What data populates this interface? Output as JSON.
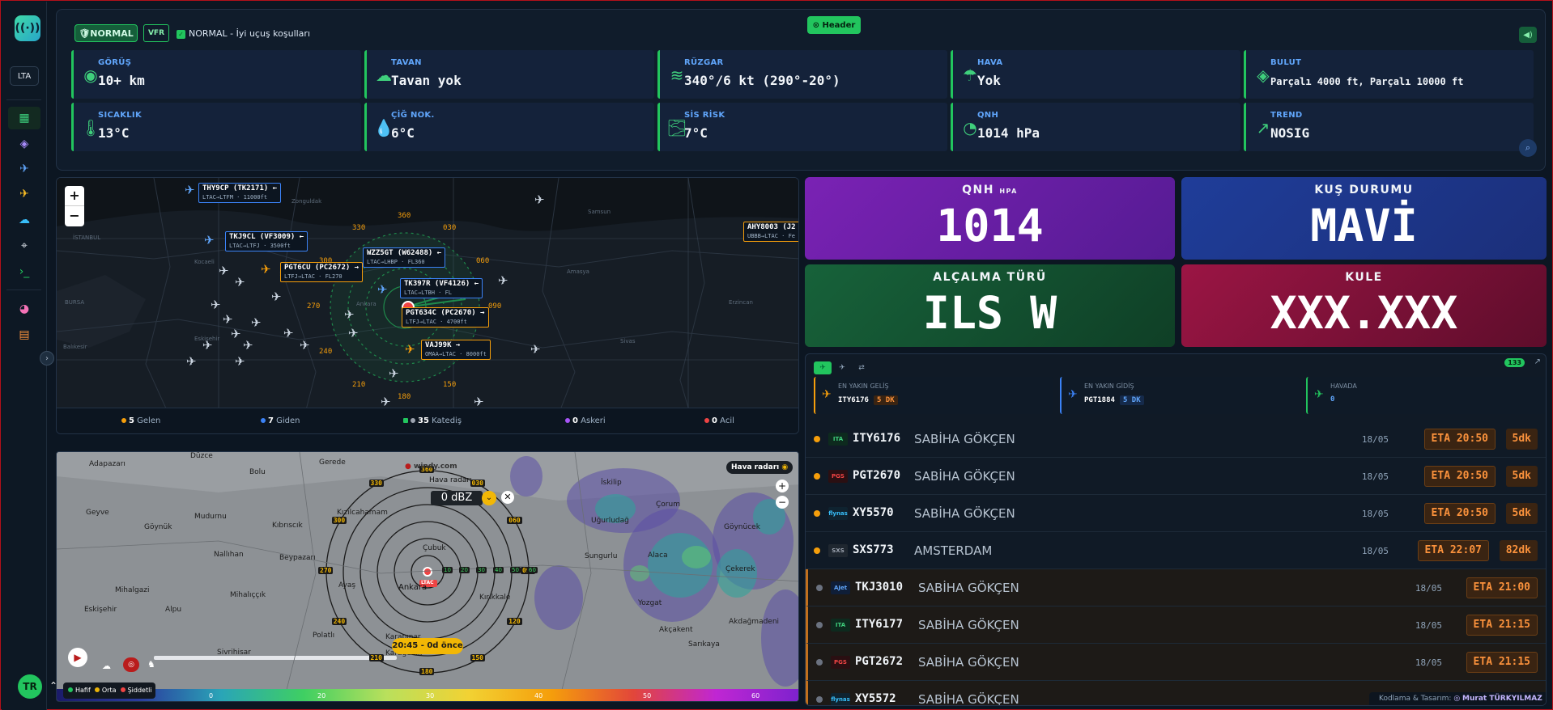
{
  "sidebar": {
    "logo_glyph": "((·))",
    "lang": "LTA",
    "icons": [
      "grid-icon",
      "layers-icon",
      "departure-plane-icon",
      "arrival-plane-icon",
      "weather-icon",
      "crosshair-icon",
      "terminal-icon",
      "palette-icon",
      "calculator-icon"
    ],
    "avatar": "TR",
    "collapse_glyph": "›"
  },
  "header_toggle": "⊙ Header",
  "status": {
    "badge": "NORMAL",
    "rule": "VFR",
    "condition": "NORMAL - İyi uçuş koşulları"
  },
  "weather": [
    {
      "label": "GÖRÜŞ",
      "value": "10+ km",
      "icon": "eye-icon",
      "glyph": "◉"
    },
    {
      "label": "TAVAN",
      "value": "Tavan yok",
      "icon": "cloud-icon",
      "glyph": "☁"
    },
    {
      "label": "RÜZGAR",
      "value": "340°/6 kt (290°-20°)",
      "icon": "wind-icon",
      "glyph": "≋"
    },
    {
      "label": "HAVA",
      "value": "Yok",
      "icon": "rain-cloud-icon",
      "glyph": "☂"
    },
    {
      "label": "BULUT",
      "value": "Parçalı 4000 ft, Parçalı 10000 ft",
      "icon": "layers-icon",
      "glyph": "◈"
    },
    {
      "label": "SICAKLIK",
      "value": "13°C",
      "icon": "thermometer-icon",
      "glyph": "🌡"
    },
    {
      "label": "ÇİĞ NOK.",
      "value": "6°C",
      "icon": "droplet-icon",
      "glyph": "💧"
    },
    {
      "label": "SİS RİSK",
      "value": "7°C",
      "icon": "fog-icon",
      "glyph": "🌫"
    },
    {
      "label": "QNH",
      "value": "1014 hPa",
      "icon": "gauge-icon",
      "glyph": "◔"
    },
    {
      "label": "TREND",
      "value": "NOSIG",
      "icon": "trend-icon",
      "glyph": "↗"
    }
  ],
  "flight_map": {
    "zoom_in": "+",
    "zoom_out": "−",
    "compass": [
      "360",
      "030",
      "060",
      "090",
      "120",
      "150",
      "180",
      "210",
      "240",
      "270",
      "300",
      "330"
    ],
    "map_labels": [
      "İSTANBUL",
      "BURSA",
      "Balıkesir",
      "Ankara",
      "Kocaeli",
      "Eskişehir",
      "Samsun",
      "Amasya",
      "Sivas",
      "Erzincan",
      "Zonguldak"
    ],
    "tags": [
      {
        "call": "THY9CP (TK2171) ←",
        "route": "LTAC→LTFM · 11000ft",
        "color": "blue"
      },
      {
        "call": "TKJ9CL (VF3009) ←",
        "route": "LTAC→LTFJ · 3500ft",
        "color": "blue"
      },
      {
        "call": "PGT6CU (PC2672) →",
        "route": "LTFJ→LTAC · FL270",
        "color": "orange"
      },
      {
        "call": "WZZ5GT (W62488) ←",
        "route": "LTAC→LHBP · FL360",
        "color": "blue"
      },
      {
        "call": "TK397R (VF4126) ←",
        "route": "LTAC→LTBH · FL",
        "color": "blue"
      },
      {
        "call": "PGT634C (PC2670) →",
        "route": "LTFJ→LTAC · 4700ft",
        "color": "orange"
      },
      {
        "call": "VAJ99K →",
        "route": "OMAA→LTAC · 8000ft",
        "color": "orange"
      },
      {
        "call": "AHY8003 (J2",
        "route": "UBBB→LTAC · Fe",
        "color": "orange"
      }
    ],
    "stats": [
      {
        "num": "5",
        "label": "Gelen",
        "color": "#f59e0b"
      },
      {
        "num": "7",
        "label": "Giden",
        "color": "#3b82f6"
      },
      {
        "num": "35",
        "label": "Katediş",
        "color": "#9ca3af"
      },
      {
        "num": "0",
        "label": "Askeri",
        "color": "#a855f7"
      },
      {
        "num": "0",
        "label": "Acil",
        "color": "#ef4444"
      }
    ]
  },
  "radar_map": {
    "cities": [
      "Adapazarı",
      "Düzce",
      "Bolu",
      "Gerede",
      "Geyve",
      "Mudurnu",
      "Kıbrıscık",
      "Göynük",
      "Nallıhan",
      "Beypazarı",
      "Mihalgazi",
      "Mihalıççık",
      "Eskişehir",
      "Alpu",
      "Ayaş",
      "Ankara",
      "Polatlı",
      "Karapınar",
      "Kırıkkale",
      "Yozgat",
      "Akçakent",
      "Sarıkaya",
      "Akdağmadeni",
      "Çorum",
      "Uğurludağ",
      "Sungurlu",
      "Alaca",
      "Çekerek",
      "İskilip",
      "Göynücek",
      "Sivrihisar",
      "Kızılcahamam",
      "Çubuk",
      "Karagedik"
    ],
    "compass": [
      "360",
      "030",
      "060",
      "090",
      "120",
      "150",
      "180",
      "210",
      "240",
      "270",
      "300",
      "330"
    ],
    "range_marks": [
      "10",
      "20",
      "30",
      "40",
      "50",
      "60"
    ],
    "dbz": "0 dBZ",
    "hava_radari": "Hava radarı",
    "hava_radari_2": "Hava radarı",
    "windy": "windy.com",
    "time": "20:45 - 0d önce",
    "airport": "LTAC",
    "scale": [
      "0",
      "20",
      "30",
      "40",
      "50",
      "60"
    ],
    "legend": [
      {
        "label": "Hafif",
        "color": "#22c55e"
      },
      {
        "label": "Orta",
        "color": "#eab308"
      },
      {
        "label": "Şiddetli",
        "color": "#ef4444"
      }
    ]
  },
  "cards": [
    {
      "title": "QNH",
      "suffix": "HPA",
      "value": "1014",
      "bg": "#6b22a8"
    },
    {
      "title": "KUŞ DURUMU",
      "suffix": "",
      "value": "MAVİ",
      "bg": "#1e3a8a"
    },
    {
      "title": "ALÇALMA TÜRÜ",
      "suffix": "",
      "value": "ILS W",
      "bg": "#14532d"
    },
    {
      "title": "KULE",
      "suffix": "",
      "value": "XXX.XXX",
      "bg": "#8a1338"
    }
  ],
  "flights": {
    "count": "133",
    "tabs": [
      "arrival-tab-icon",
      "departure-tab-icon",
      "swap-icon"
    ],
    "nearest": [
      {
        "label": "EN YAKIN GELİŞ",
        "flight": "ITY6176",
        "badge": "5 DK",
        "color": "#f59e0b"
      },
      {
        "label": "EN YAKIN GİDİŞ",
        "flight": "PGT1884",
        "badge": "5 DK",
        "color": "#3b82f6"
      },
      {
        "label": "HAVADA",
        "flight": "0",
        "badge": "",
        "color": "#22c55e"
      }
    ],
    "rows": [
      {
        "call": "ITY6176",
        "airport": "SABİHA GÖKÇEN",
        "date": "18/05",
        "eta": "ETA 20:50",
        "dk": "5dk",
        "logo": "ITA",
        "status": "active"
      },
      {
        "call": "PGT2670",
        "airport": "SABİHA GÖKÇEN",
        "date": "18/05",
        "eta": "ETA 20:50",
        "dk": "5dk",
        "logo": "PGS",
        "status": "active"
      },
      {
        "call": "XY5570",
        "airport": "SABİHA GÖKÇEN",
        "date": "18/05",
        "eta": "ETA 20:50",
        "dk": "5dk",
        "logo": "flynas",
        "status": "active"
      },
      {
        "call": "SXS773",
        "airport": "AMSTERDAM",
        "date": "18/05",
        "eta": "ETA 22:07",
        "dk": "82dk",
        "logo": "SXS",
        "status": "active"
      },
      {
        "call": "TKJ3010",
        "airport": "SABİHA GÖKÇEN",
        "date": "18/05",
        "eta": "ETA 21:00",
        "dk": "",
        "logo": "AJet",
        "status": "sched"
      },
      {
        "call": "ITY6177",
        "airport": "SABİHA GÖKÇEN",
        "date": "18/05",
        "eta": "ETA 21:15",
        "dk": "",
        "logo": "ITA",
        "status": "sched"
      },
      {
        "call": "PGT2672",
        "airport": "SABİHA GÖKÇEN",
        "date": "18/05",
        "eta": "ETA 21:15",
        "dk": "",
        "logo": "PGS",
        "status": "sched"
      },
      {
        "call": "XY5572",
        "airport": "SABİHA GÖKÇEN",
        "date": "",
        "eta": "",
        "dk": "",
        "logo": "flynas",
        "status": "sched"
      }
    ]
  },
  "credit": {
    "label": "Kodlama & Tasarım:",
    "name": "Murat TÜRKYILMAZ"
  }
}
